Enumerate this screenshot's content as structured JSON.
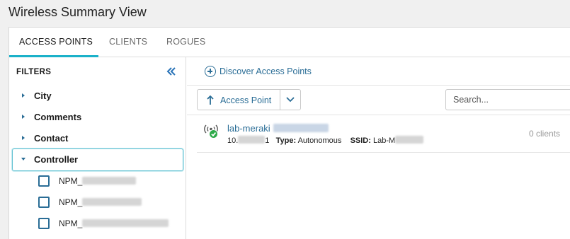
{
  "page": {
    "title": "Wireless Summary View"
  },
  "tabs": [
    {
      "label": "ACCESS POINTS",
      "active": true
    },
    {
      "label": "CLIENTS",
      "active": false
    },
    {
      "label": "ROGUES",
      "active": false
    }
  ],
  "sidebar": {
    "title": "FILTERS",
    "collapse_icon": "double-chevron-left-icon",
    "filters": [
      {
        "label": "City",
        "expanded": false
      },
      {
        "label": "Comments",
        "expanded": false
      },
      {
        "label": "Contact",
        "expanded": false
      },
      {
        "label": "Controller",
        "expanded": true
      }
    ],
    "controller_options": [
      {
        "label": "NPM_",
        "checked": false
      },
      {
        "label": "NPM_",
        "checked": false
      },
      {
        "label": "NPM_",
        "checked": false
      }
    ]
  },
  "toolbar": {
    "discover_label": "Discover Access Points",
    "sort_label": "Access Point",
    "search_placeholder": "Search..."
  },
  "access_points": [
    {
      "name": "lab-meraki",
      "ip_prefix": "10.",
      "ip_suffix": "1",
      "type_label": "Type:",
      "type_value": "Autonomous",
      "ssid_label": "SSID:",
      "ssid_value": "Lab-M",
      "clients": "0 clients",
      "status": "up",
      "status_color": "#2eaa4a"
    }
  ],
  "colors": {
    "accent": "#1ab1c9",
    "link": "#2a6d96"
  }
}
